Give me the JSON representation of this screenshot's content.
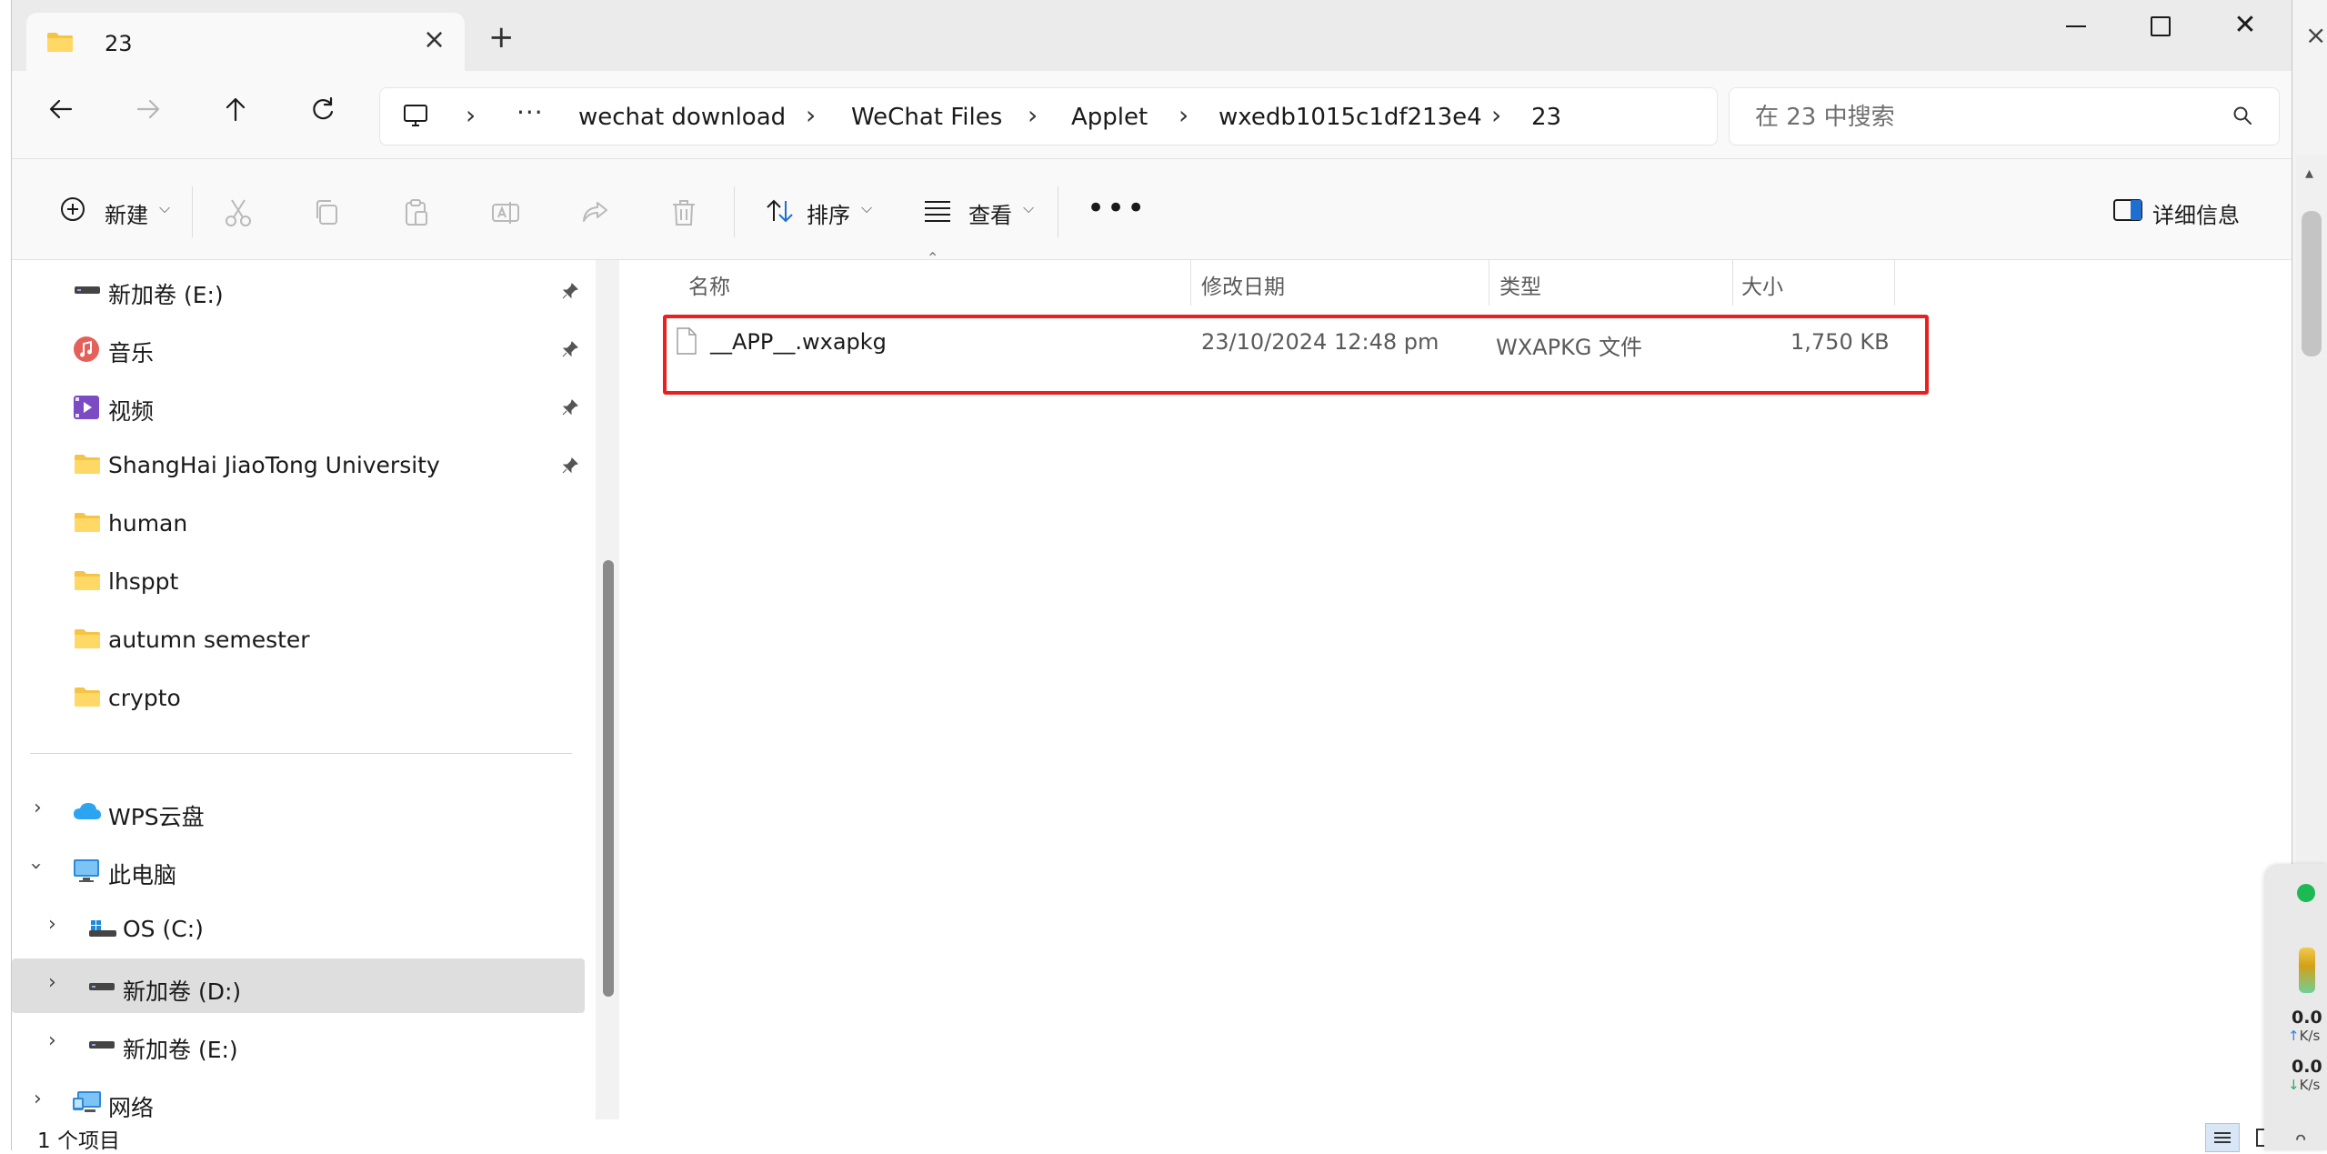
{
  "window": {
    "tab_title": "23",
    "new_tab": "+",
    "close_tab": "×"
  },
  "address": {
    "more": "···",
    "crumbs": [
      "wechat download",
      "WeChat Files",
      "Applet",
      "wxedb1015c1df213e4",
      "23"
    ]
  },
  "search": {
    "placeholder": "在 23 中搜索"
  },
  "commands": {
    "new": "新建",
    "sort": "排序",
    "view": "查看",
    "details": "详细信息"
  },
  "sidebar": {
    "pinned": [
      {
        "label": "新加卷 (E:)"
      },
      {
        "label": "音乐"
      },
      {
        "label": "视频"
      },
      {
        "label": "ShangHai JiaoTong University"
      },
      {
        "label": "human"
      },
      {
        "label": "lhsppt"
      },
      {
        "label": "autumn semester"
      },
      {
        "label": "crypto"
      }
    ],
    "tree": [
      {
        "label": "WPS云盘"
      },
      {
        "label": "此电脑"
      },
      {
        "label": "OS (C:)"
      },
      {
        "label": "新加卷 (D:)"
      },
      {
        "label": "新加卷 (E:)"
      },
      {
        "label": "网络"
      }
    ]
  },
  "columns": {
    "name": "名称",
    "modified": "修改日期",
    "type": "类型",
    "size": "大小"
  },
  "files": [
    {
      "name": "__APP__.wxapkg",
      "modified": "23/10/2024 12:48 pm",
      "type": "WXAPKG 文件",
      "size": "1,750 KB"
    }
  ],
  "status": {
    "count": "1 个项目"
  },
  "net_widget": {
    "up_value": "0.0",
    "up_unit": "K/s",
    "down_value": "0.0",
    "down_unit": "K/s"
  },
  "colors": {
    "highlight_box": "#e8201f",
    "folder": "#f6c445",
    "selected_row": "#dedede"
  }
}
